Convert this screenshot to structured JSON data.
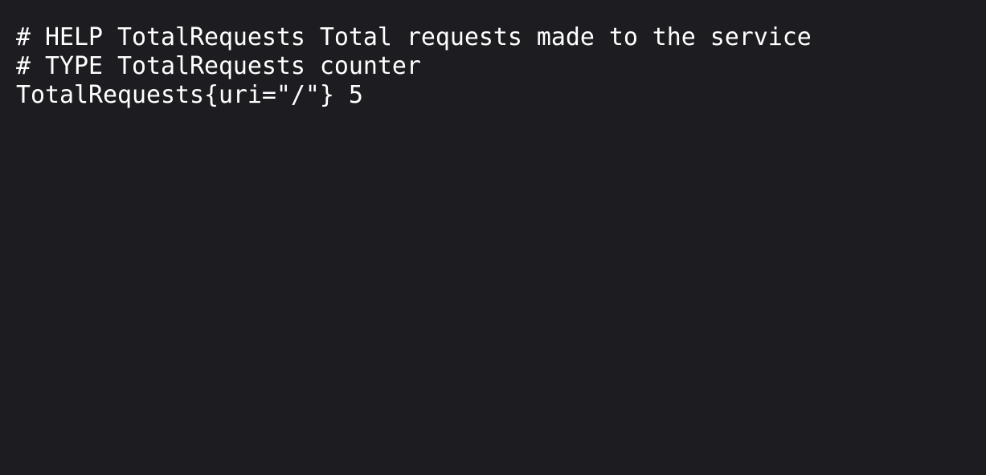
{
  "metrics": {
    "lines": [
      "# HELP TotalRequests Total requests made to the service",
      "# TYPE TotalRequests counter",
      "TotalRequests{uri=\"/\"} 5"
    ],
    "metric_name": "TotalRequests",
    "help_text": "Total requests made to the service",
    "type": "counter",
    "label": {
      "uri": "/"
    },
    "value": 5
  },
  "colors": {
    "background": "#1d1c21",
    "text": "#ffffff"
  }
}
